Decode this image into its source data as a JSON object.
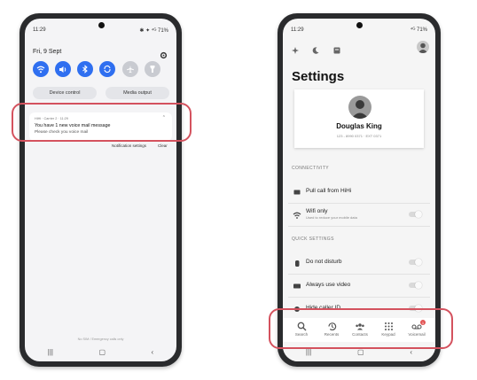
{
  "left_phone": {
    "status_time": "11:29",
    "status_right": "✱ ✦ ⁴ᴳ 71%",
    "date": "Fri, 9 Sept",
    "quick_icons": [
      "wifi-icon",
      "sound-icon",
      "bluetooth-icon",
      "auto-rotate-icon",
      "airplane-mode-icon",
      "flashlight-icon"
    ],
    "device_control": "Device control",
    "media_output": "Media output",
    "notification": {
      "meta": "HiHi · Carrier 2 · 11:29",
      "title": "You have 1 new voice mail message",
      "body": "Please check you voice mail"
    },
    "notification_settings": "Notification settings",
    "clear": "Clear",
    "footer": "No SIM / Emergency calls only"
  },
  "right_phone": {
    "status_time": "11:29",
    "status_right": "⁴ᴳ 71%",
    "page_title": "Settings",
    "profile_name": "Douglas King",
    "profile_sub": "123 - 8990 0371 · EXT 0371",
    "section_connectivity": "CONNECTIVITY",
    "pull_call": "Pull call from HiHi",
    "wifi_only": "Wifi only",
    "wifi_only_sub": "Used to reduce your mobile data",
    "section_quick": "QUICK SETTINGS",
    "do_not_disturb": "Do not disturb",
    "always_video": "Always use video",
    "hide_caller": "Hide caller ID",
    "tabs": [
      "Search",
      "Recents",
      "Contacts",
      "Keypad",
      "Voicemail"
    ],
    "voicemail_badge": "1"
  }
}
